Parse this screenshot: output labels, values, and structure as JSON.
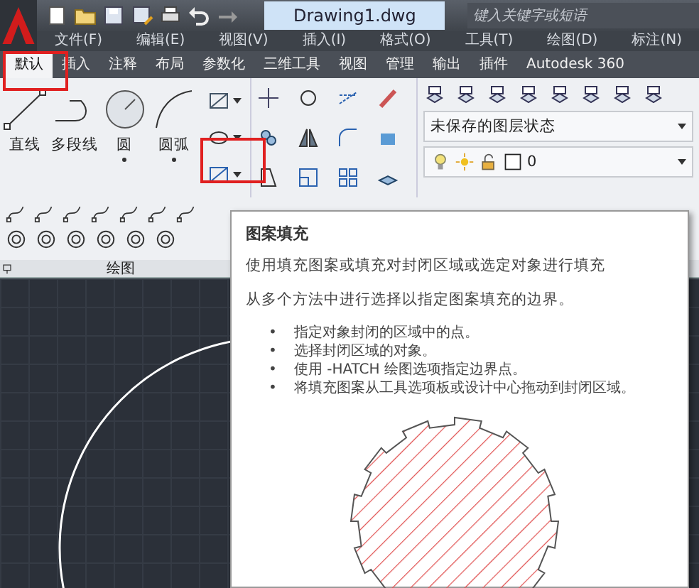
{
  "file_tab": {
    "label": "Drawing1.dwg"
  },
  "search": {
    "placeholder": "键入关键字或短语"
  },
  "menu": [
    "文件(F)",
    "编辑(E)",
    "视图(V)",
    "插入(I)",
    "格式(O)",
    "工具(T)",
    "绘图(D)",
    "标注(N)"
  ],
  "ribbon_tabs": [
    {
      "label": "默认",
      "selected": true
    },
    {
      "label": "插入",
      "selected": false
    },
    {
      "label": "注释",
      "selected": false
    },
    {
      "label": "布局",
      "selected": false
    },
    {
      "label": "参数化",
      "selected": false
    },
    {
      "label": "三维工具",
      "selected": false
    },
    {
      "label": "视图",
      "selected": false
    },
    {
      "label": "管理",
      "selected": false
    },
    {
      "label": "输出",
      "selected": false
    },
    {
      "label": "插件",
      "selected": false
    },
    {
      "label": "Autodesk 360",
      "selected": false
    }
  ],
  "draw_panel": {
    "title": "绘图",
    "large_tools": [
      {
        "label": "直线",
        "kind": "line",
        "has_menu": false
      },
      {
        "label": "多段线",
        "kind": "polyline",
        "has_menu": false
      },
      {
        "label": "圆",
        "kind": "circle",
        "has_menu": true
      },
      {
        "label": "圆弧",
        "kind": "arc",
        "has_menu": true
      }
    ]
  },
  "layers": {
    "state": "未保存的图层状态",
    "current_layer": "0"
  },
  "tooltip": {
    "title": "图案填充",
    "description": "使用填充图案或填充对封闭区域或选定对象进行填充",
    "intro": "从多个方法中进行选择以指定图案填充的边界。",
    "bullet_marker": "•",
    "bullets": [
      "指定对象封闭的区域中的点。",
      "选择封闭区域的对象。",
      "使用 -HATCH 绘图选项指定边界点。",
      "将填充图案从工具选项板或设计中心拖动到封闭区域。"
    ]
  }
}
